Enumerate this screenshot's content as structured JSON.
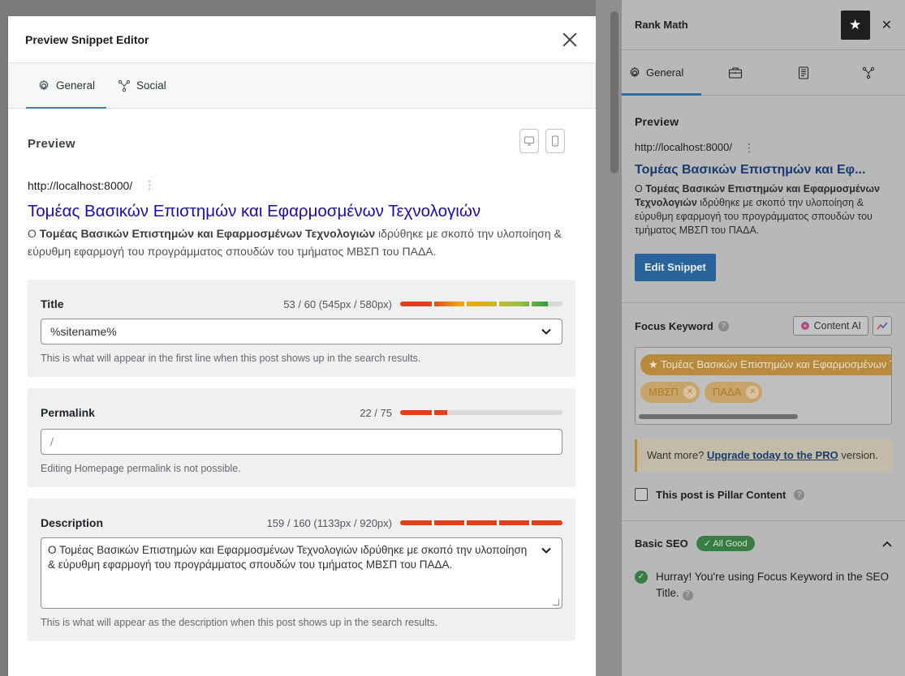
{
  "modal": {
    "title": "Preview Snippet Editor",
    "tabs": [
      {
        "label": "General",
        "icon": "gear-icon"
      },
      {
        "label": "Social",
        "icon": "share-icon"
      }
    ],
    "preview_label": "Preview",
    "serp": {
      "url": "http://localhost:8000/",
      "title": "Τομέας Βασικών Επιστημών και Εφαρμοσμένων Τεχνολογιών",
      "desc_bold": "Τομέας Βασικών Επιστημών και Εφαρμοσμένων Τεχνολογιών",
      "desc_prefix": "Ο ",
      "desc_rest": " ιδρύθηκε με σκοπό την υλοποίηση & εύρυθμη εφαρμογή του προγράμματος σπουδών του τμήματος ΜΒΣΠ του ΠΑΔΑ."
    },
    "title_field": {
      "label": "Title",
      "counter": "53 / 60 (545px / 580px)",
      "value": "%sitename%",
      "help": "This is what will appear in the first line when this post shows up in the search results.",
      "fill": 0.91,
      "colors": [
        "#e2401c",
        "#e2401c",
        "#f0a30a",
        "#d9b02a",
        "#9cc43a",
        "#2e9e3f"
      ]
    },
    "permalink_field": {
      "label": "Permalink",
      "counter": "22 / 75",
      "value": "/",
      "help": "Editing Homepage permalink is not possible.",
      "fill": 0.29
    },
    "description_field": {
      "label": "Description",
      "counter": "159 / 160 (1133px / 920px)",
      "value": "Ο Τομέας Βασικών Επιστημών και Εφαρμοσμένων Τεχνολογιών ιδρύθηκε με σκοπό την υλοποίηση & εύρυθμη εφαρμογή του προγράμματος σπουδών του τμήματος ΜΒΣΠ του ΠΑΔΑ.",
      "help": "This is what will appear as the description when this post shows up in the search results.",
      "fill": 1.0
    }
  },
  "sidebar": {
    "title": "Rank Math",
    "close": "✕",
    "tab_general": "General",
    "preview_label": "Preview",
    "url": "http://localhost:8000/",
    "serp_title": "Τομέας Βασικών Επιστημών και Εφ...",
    "desc_prefix": "Ο ",
    "desc_bold": "Τομέας Βασικών Επιστημών και Εφαρμοσμένων Τεχνολογιών",
    "desc_rest": " ιδρύθηκε με σκοπό την υλοποίηση & εύρυθμη εφαρμογή του προγράμματος σπουδών του τμήματος ΜΒΣΠ του ΠΑΔΑ.",
    "edit_snippet": "Edit Snippet",
    "focus_keyword_label": "Focus Keyword",
    "content_ai": "Content AI",
    "keywords": {
      "primary": "★ Τομέας Βασικών Επιστημών και Εφαρμοσμένων Τεχνολογιών",
      "secondary": [
        "ΜΒΣΠ",
        "ΠΑΔΑ"
      ]
    },
    "upgrade": {
      "prefix": "Want more? ",
      "link": "Upgrade today to the PRO",
      "suffix": " version."
    },
    "pillar_label": "This post is Pillar Content",
    "basic_seo": {
      "label": "Basic SEO",
      "badge": "✓ All Good",
      "item1": "Hurray! You're using Focus Keyword in the SEO Title."
    }
  },
  "colors": {
    "link_blue": "#1a0dab",
    "accent_blue": "#3582c4",
    "red": "#e2401c",
    "sidebar_button": "#28639c"
  }
}
